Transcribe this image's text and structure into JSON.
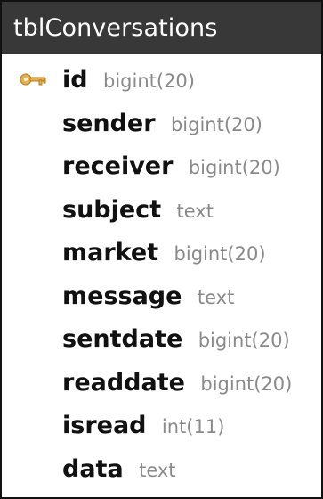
{
  "table": {
    "name": "tblConversations",
    "columns": [
      {
        "name": "id",
        "type": "bigint(20)",
        "primary_key": true,
        "icon": "key-icon"
      },
      {
        "name": "sender",
        "type": "bigint(20)",
        "primary_key": false
      },
      {
        "name": "receiver",
        "type": "bigint(20)",
        "primary_key": false
      },
      {
        "name": "subject",
        "type": "text",
        "primary_key": false
      },
      {
        "name": "market",
        "type": "bigint(20)",
        "primary_key": false
      },
      {
        "name": "message",
        "type": "text",
        "primary_key": false
      },
      {
        "name": "sentdate",
        "type": "bigint(20)",
        "primary_key": false
      },
      {
        "name": "readdate",
        "type": "bigint(20)",
        "primary_key": false
      },
      {
        "name": "isread",
        "type": "int(11)",
        "primary_key": false
      },
      {
        "name": "data",
        "type": "text",
        "primary_key": false
      }
    ]
  },
  "colors": {
    "header_background": "#383838",
    "header_text": "#ffffff",
    "column_name": "#111111",
    "column_type": "#8a8a8a",
    "key_icon": "#e0a93b"
  }
}
